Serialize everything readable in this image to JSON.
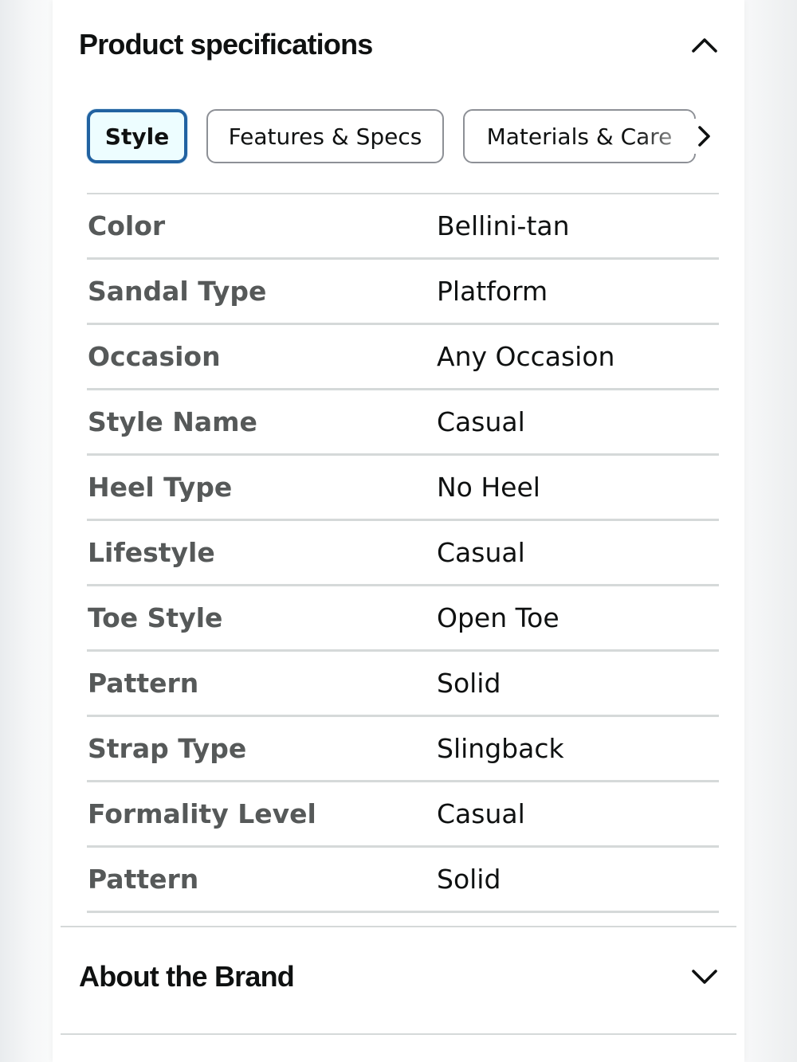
{
  "product_specs": {
    "title": "Product specifications",
    "collapse_icon": "chevron-up-icon"
  },
  "tabs": [
    {
      "label": "Style",
      "active": true
    },
    {
      "label": "Features & Specs",
      "active": false
    },
    {
      "label": "Materials & Care",
      "active": false
    }
  ],
  "tabs_next_icon": "chevron-right-icon",
  "specs": [
    {
      "key": "Color",
      "value": "Bellini-tan"
    },
    {
      "key": "Sandal Type",
      "value": "Platform"
    },
    {
      "key": "Occasion",
      "value": "Any Occasion"
    },
    {
      "key": "Style Name",
      "value": "Casual"
    },
    {
      "key": "Heel Type",
      "value": "No Heel"
    },
    {
      "key": "Lifestyle",
      "value": "Casual"
    },
    {
      "key": "Toe Style",
      "value": "Open Toe"
    },
    {
      "key": "Pattern",
      "value": "Solid"
    },
    {
      "key": "Strap Type",
      "value": "Slingback"
    },
    {
      "key": "Formality Level",
      "value": "Casual"
    },
    {
      "key": "Pattern",
      "value": "Solid"
    }
  ],
  "about_brand": {
    "title": "About the Brand",
    "expand_icon": "chevron-down-icon"
  },
  "colors": {
    "active_tab_border": "#2162a1",
    "active_tab_bg": "#edfdff",
    "key_text": "#565959",
    "value_text": "#0f1111",
    "divider": "#d5d9d9"
  }
}
